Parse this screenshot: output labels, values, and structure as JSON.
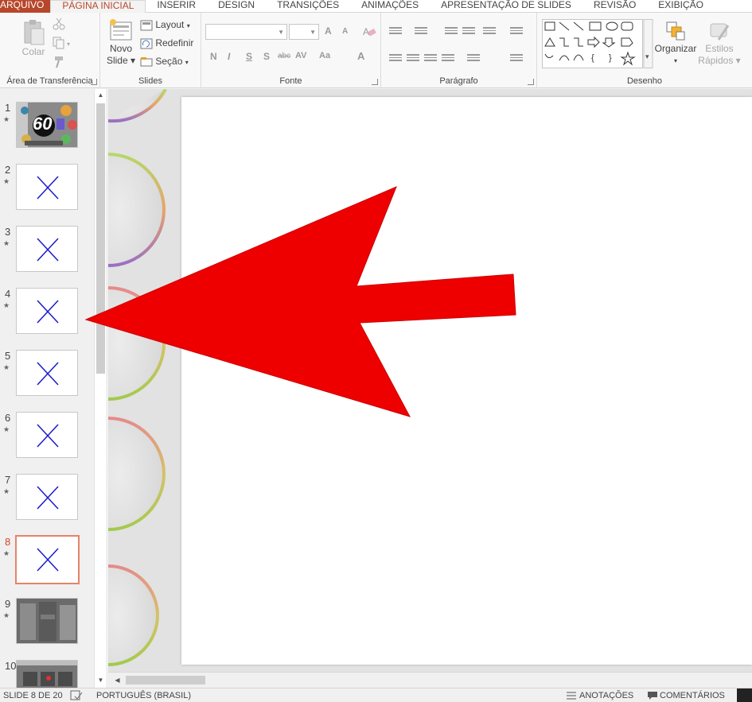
{
  "tabs": [
    {
      "label": "ARQUIVO",
      "active": false
    },
    {
      "label": "PÁGINA INICIAL",
      "active": true
    },
    {
      "label": "INSERIR",
      "active": false
    },
    {
      "label": "DESIGN",
      "active": false
    },
    {
      "label": "TRANSIÇÕES",
      "active": false
    },
    {
      "label": "ANIMAÇÕES",
      "active": false
    },
    {
      "label": "APRESENTAÇÃO DE SLIDES",
      "active": false
    },
    {
      "label": "REVISÃO",
      "active": false
    },
    {
      "label": "EXIBIÇÃO",
      "active": false
    }
  ],
  "ribbon": {
    "clipboard": {
      "label": "Área de Transferência",
      "paste": "Colar"
    },
    "slides": {
      "label": "Slides",
      "new_slide_1": "Novo",
      "new_slide_2": "Slide",
      "layout": "Layout",
      "reset": "Redefinir",
      "section": "Seção"
    },
    "font": {
      "label": "Fonte",
      "font_name": "",
      "font_size": "",
      "bold": "N",
      "italic": "I",
      "underline": "S",
      "shadow": "S",
      "strike": "abc",
      "spacing": "AV",
      "case": "Aa",
      "color": "A",
      "grow": "A",
      "shrink": "A"
    },
    "paragraph": {
      "label": "Parágrafo"
    },
    "drawing": {
      "label": "Desenho",
      "arrange": "Organizar",
      "quick_styles_1": "Estilos",
      "quick_styles_2": "Rápidos"
    }
  },
  "thumbnails": [
    {
      "number": "1",
      "star": "★",
      "kind": "image-60"
    },
    {
      "number": "2",
      "star": "★",
      "kind": "missing"
    },
    {
      "number": "3",
      "star": "★",
      "kind": "missing"
    },
    {
      "number": "4",
      "star": "★",
      "kind": "missing"
    },
    {
      "number": "5",
      "star": "★",
      "kind": "missing"
    },
    {
      "number": "6",
      "star": "★",
      "kind": "missing"
    },
    {
      "number": "7",
      "star": "★",
      "kind": "missing"
    },
    {
      "number": "8",
      "star": "★",
      "kind": "missing",
      "selected": true
    },
    {
      "number": "9",
      "star": "★",
      "kind": "image-grey"
    },
    {
      "number": "10",
      "star": "",
      "kind": "image-partial"
    }
  ],
  "thumb1_text": "60",
  "status": {
    "slide": "SLIDE 8 DE 20",
    "language": "PORTUGUÊS (BRASIL)",
    "notes": "ANOTAÇÕES",
    "comments": "COMENTÁRIOS"
  },
  "colors": {
    "accent": "#b7472a",
    "arrow": "#ee0000",
    "missing_x": "#1a1acc",
    "selected_border": "#e8826a"
  }
}
